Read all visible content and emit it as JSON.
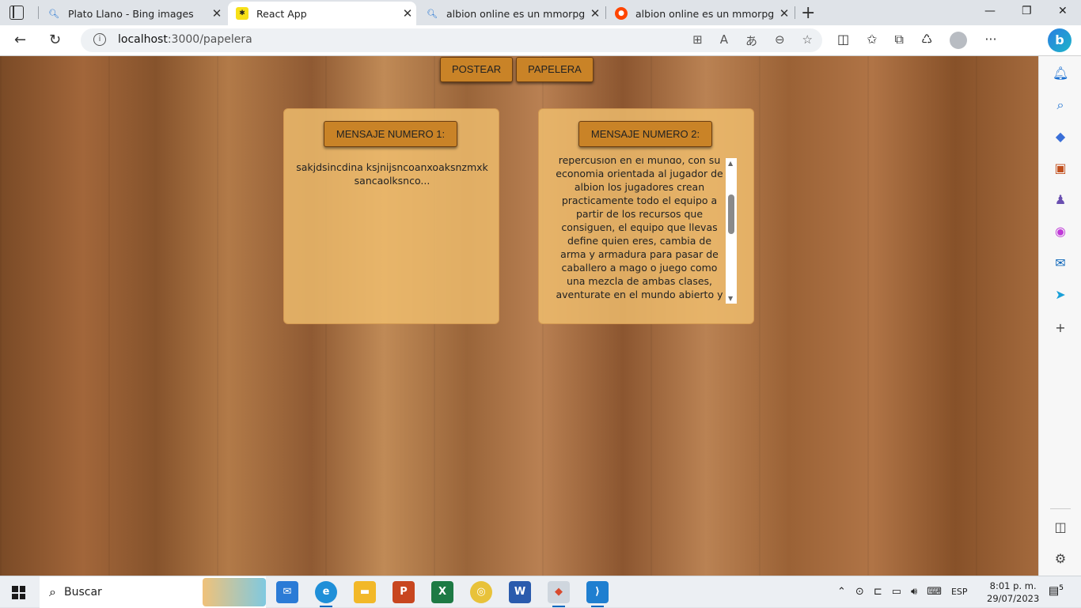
{
  "browser": {
    "tabs": [
      {
        "title": "Plato Llano - Bing images",
        "icon": "search-icon",
        "active": false
      },
      {
        "title": "React App",
        "icon": "react-icon",
        "active": true
      },
      {
        "title": "albion online es un mmorpg no l",
        "icon": "search-icon",
        "active": false
      },
      {
        "title": "albion online es un mmorpg no l",
        "icon": "reddit-icon",
        "active": false
      }
    ],
    "url_host": "localhost",
    "url_path": ":3000/papelera"
  },
  "nav": {
    "post_label": "POSTEAR",
    "trash_label": "PAPELERA"
  },
  "cards": [
    {
      "header": "MENSAJE NUMERO 1:",
      "text": "sakjdsincdina ksjnijsncoanxoaksnzmxksancaolksnco..."
    },
    {
      "header": "MENSAJE NUMERO 2:",
      "text": "repercusion en el mundo, con su economia orientada al jugador de albion los jugadores crean practicamente todo el equipo a partir de los recursos que consiguen, el equipo que llevas define quien eres, cambia de arma y armadura para pasar de caballero a mago o juego como una mezcla de ambas clases, aventurate en el mundo abierto y haz frente a los habitantes"
    }
  ],
  "taskbar": {
    "search_label": "Buscar",
    "lang": "ESP",
    "time": "8:01 p. m.",
    "date": "29/07/2023",
    "notif_count": "5"
  }
}
